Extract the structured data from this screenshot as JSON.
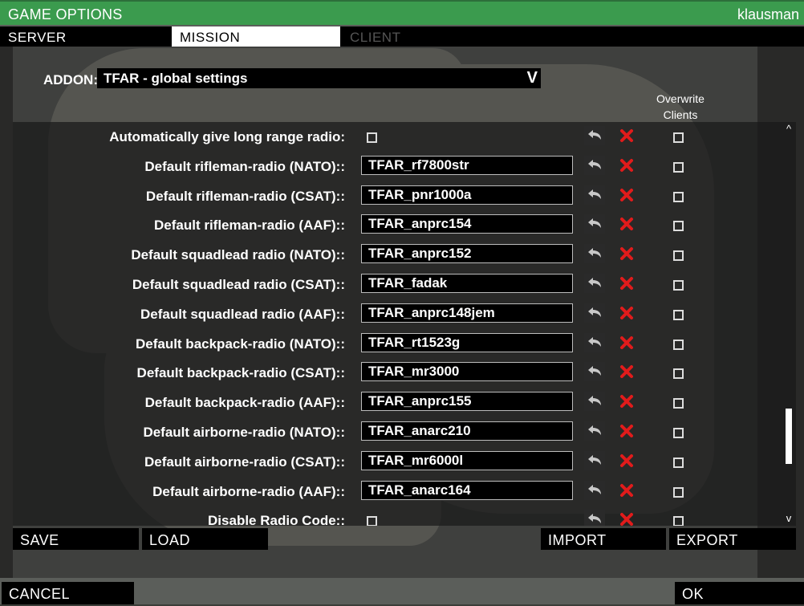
{
  "window": {
    "title": "GAME OPTIONS",
    "user": "klausman"
  },
  "tabs": [
    {
      "label": "SERVER"
    },
    {
      "label": "MISSION"
    },
    {
      "label": "CLIENT"
    }
  ],
  "addon": {
    "label": "ADDON:",
    "selected": "TFAR - global settings",
    "chevron": "V"
  },
  "overwrite_header": [
    "Overwrite",
    "Clients"
  ],
  "settings": [
    {
      "label": "Automatically give long range radio:",
      "type": "checkbox"
    },
    {
      "label": "Default rifleman-radio (NATO)::",
      "type": "text",
      "value": "TFAR_rf7800str"
    },
    {
      "label": "Default rifleman-radio (CSAT)::",
      "type": "text",
      "value": "TFAR_pnr1000a"
    },
    {
      "label": "Default rifleman-radio (AAF)::",
      "type": "text",
      "value": "TFAR_anprc154"
    },
    {
      "label": "Default squadlead radio (NATO)::",
      "type": "text",
      "value": "TFAR_anprc152"
    },
    {
      "label": "Default squadlead radio (CSAT)::",
      "type": "text",
      "value": "TFAR_fadak"
    },
    {
      "label": "Default squadlead radio (AAF)::",
      "type": "text",
      "value": "TFAR_anprc148jem"
    },
    {
      "label": "Default backpack-radio (NATO)::",
      "type": "text",
      "value": "TFAR_rt1523g"
    },
    {
      "label": "Default backpack-radio (CSAT)::",
      "type": "text",
      "value": "TFAR_mr3000"
    },
    {
      "label": "Default backpack-radio (AAF)::",
      "type": "text",
      "value": "TFAR_anprc155"
    },
    {
      "label": "Default airborne-radio (NATO)::",
      "type": "text",
      "value": "TFAR_anarc210"
    },
    {
      "label": "Default airborne-radio (CSAT)::",
      "type": "text",
      "value": "TFAR_mr6000l"
    },
    {
      "label": "Default airborne-radio (AAF)::",
      "type": "text",
      "value": "TFAR_anarc164"
    },
    {
      "label": "Disable Radio Code::",
      "type": "checkbox"
    }
  ],
  "icons": {
    "reset": "undo-arrow-icon",
    "delete": "red-x-icon",
    "delete_color": "#e11b1b"
  },
  "scrollbar": {
    "up": "^",
    "down": "v"
  },
  "buttons": {
    "save": "SAVE",
    "load": "LOAD",
    "import": "IMPORT",
    "export": "EXPORT",
    "cancel": "CANCEL",
    "ok": "OK"
  },
  "colors": {
    "title_bar": "#3b9b4e",
    "active_tab": "#ffffff"
  }
}
